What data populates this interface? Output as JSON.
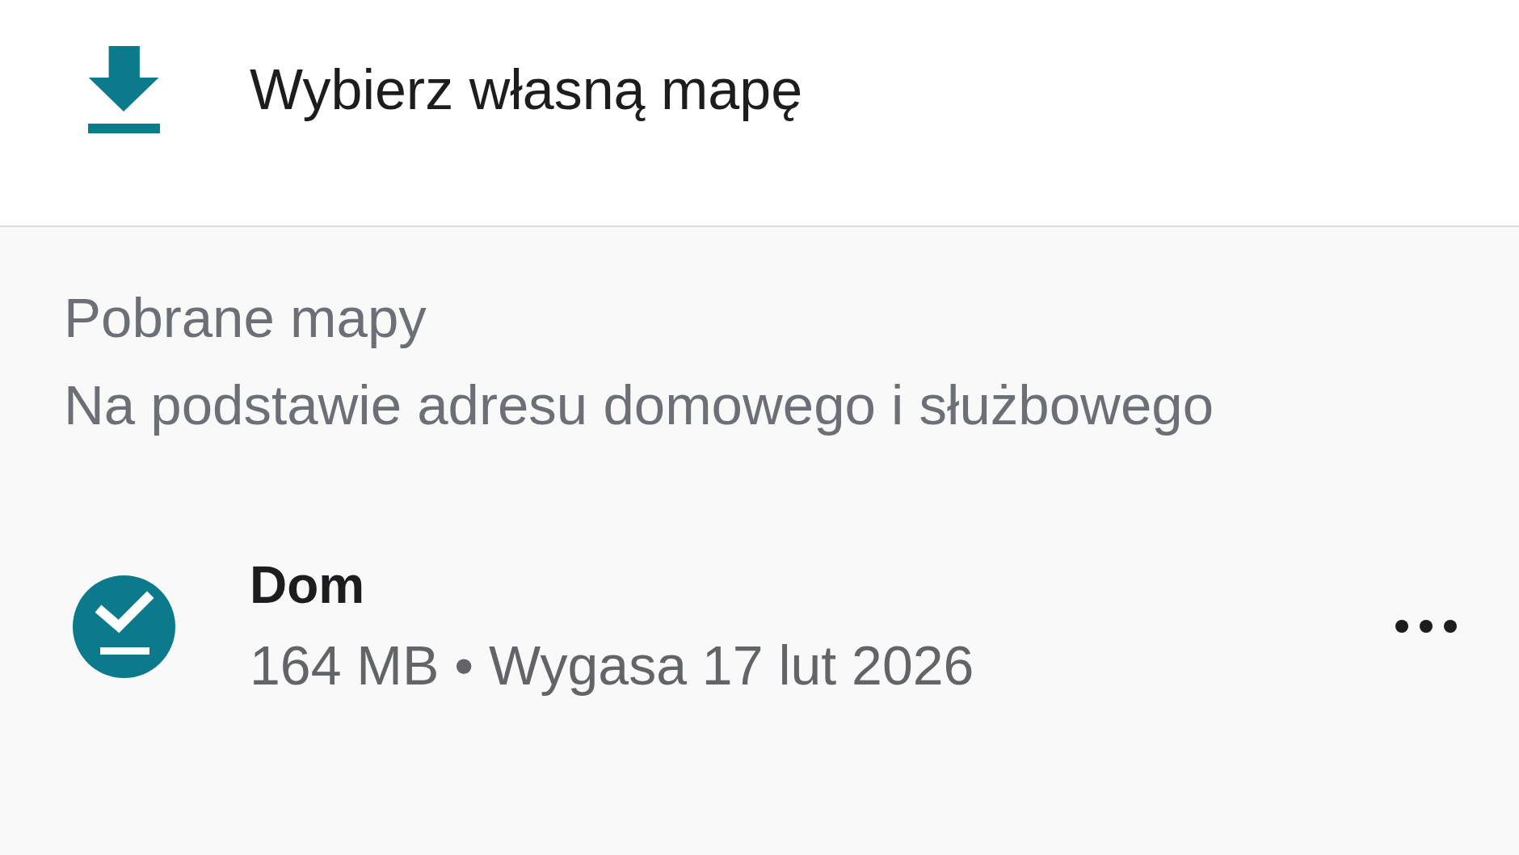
{
  "header": {
    "action": {
      "label": "Wybierz własną mapę"
    }
  },
  "section": {
    "title": "Pobrane mapy",
    "subtitle": "Na podstawie adresu domowego i służbowego"
  },
  "maps": [
    {
      "name": "Dom",
      "details": "164 MB • Wygasa 17 lut 2026",
      "downloaded": true
    }
  ]
}
